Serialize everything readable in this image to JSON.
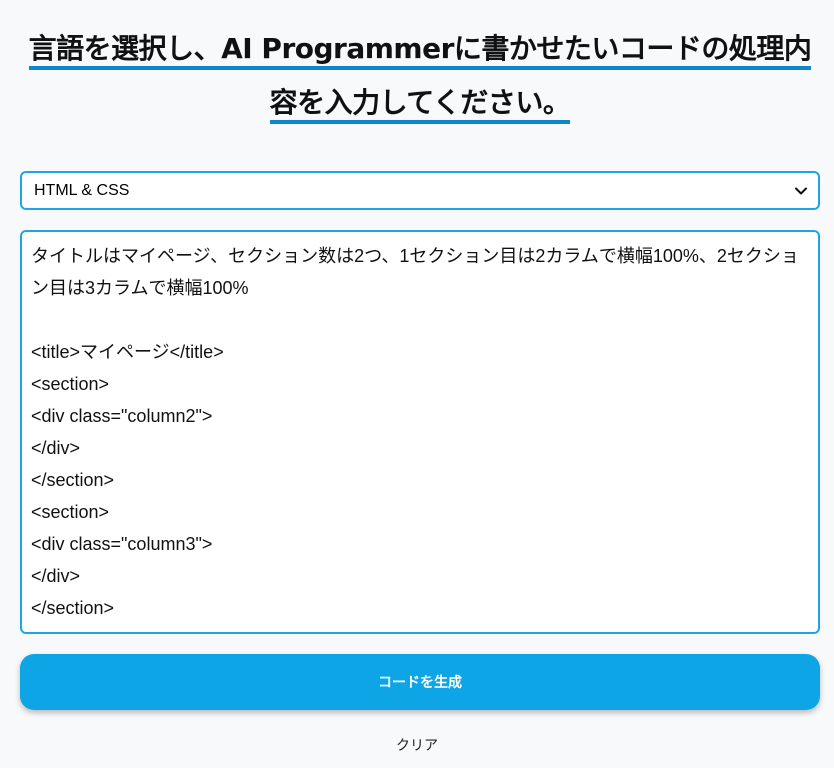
{
  "heading": {
    "text": "言語を選択し、AI Programmerに書かせたいコードの処理内容を入力してください。",
    "accent_color": "#0e86c9"
  },
  "language_select": {
    "selected": "HTML & CSS",
    "icon": "chevron-down-icon",
    "border_color": "#1ea5e2"
  },
  "prompt_input": {
    "lines": [
      "タイトルはマイページ、セクション数は2つ、1セクション目は2カラムで横幅100%、2セクション目は3カラムで横幅100%",
      "",
      "<title>マイページ</title>",
      "<section>",
      "<div class=\"column2\">",
      "</div>",
      "</section>",
      "<section>",
      "<div class=\"column3\">",
      "</div>",
      "</section>"
    ]
  },
  "generate_button": {
    "label": "コードを生成",
    "color": "#0ea5e6"
  },
  "clear_link": {
    "label": "クリア"
  }
}
